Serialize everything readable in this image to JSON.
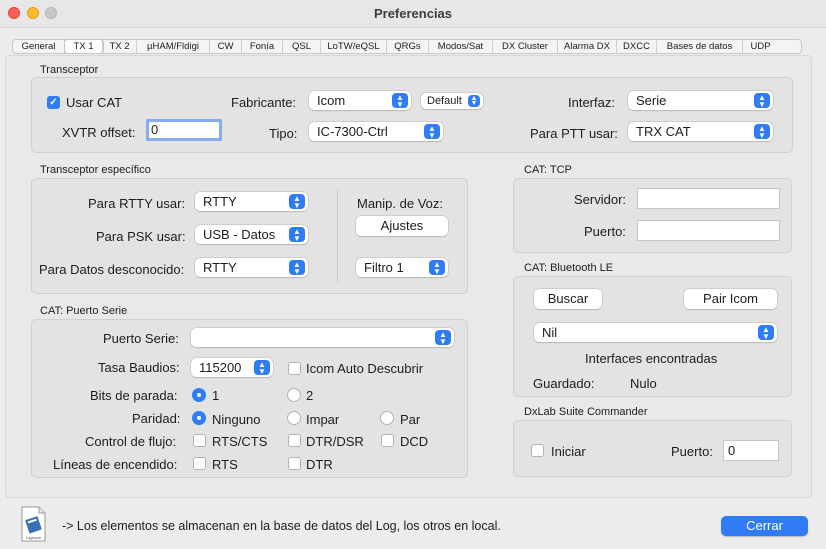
{
  "window": {
    "title": "Preferencias"
  },
  "tabs": [
    "General",
    "TX 1",
    "TX 2",
    "µHAM/Fldigi",
    "CW",
    "Fonía",
    "QSL",
    "LoTW/eQSL",
    "QRGs",
    "Modos/Sat",
    "DX Cluster",
    "Alarma DX",
    "DXCC",
    "Bases de datos",
    "UDP"
  ],
  "active_tab": "TX 1",
  "transceptor": {
    "title": "Transceptor",
    "usar_cat_label": "Usar CAT",
    "usar_cat_checked": true,
    "xvtr_label": "XVTR offset:",
    "xvtr_value": "0",
    "fabricante_label": "Fabricante:",
    "fabricante_value": "Icom",
    "default_value": "Default",
    "tipo_label": "Tipo:",
    "tipo_value": "IC-7300-Ctrl",
    "interfaz_label": "Interfaz:",
    "interfaz_value": "Serie",
    "ptt_label": "Para PTT usar:",
    "ptt_value": "TRX CAT"
  },
  "especifico": {
    "title": "Transceptor específico",
    "rtty_label": "Para RTTY usar:",
    "rtty_value": "RTTY",
    "psk_label": "Para PSK usar:",
    "psk_value": "USB - Datos",
    "datos_label": "Para Datos desconocido:",
    "datos_value": "RTTY",
    "manip_label": "Manip. de Voz:",
    "ajustes_label": "Ajustes",
    "filtro_value": "Filtro 1"
  },
  "puerto_serie": {
    "title": "CAT: Puerto Serie",
    "puerto_label": "Puerto Serie:",
    "puerto_value": "",
    "baudios_label": "Tasa Baudios:",
    "baudios_value": "115200",
    "auto_label": "Icom Auto Descubrir",
    "bits_label": "Bits de parada:",
    "bits_options": [
      "1",
      "2"
    ],
    "bits_selected": "1",
    "paridad_label": "Paridad:",
    "paridad_options": [
      "Ninguno",
      "Impar",
      "Par"
    ],
    "paridad_selected": "Ninguno",
    "flujo_label": "Control de flujo:",
    "flujo_options": [
      "RTS/CTS",
      "DTR/DSR",
      "DCD"
    ],
    "lineas_label": "Líneas de encendido:",
    "lineas_options": [
      "RTS",
      "DTR"
    ]
  },
  "tcp": {
    "title": "CAT: TCP",
    "servidor_label": "Servidor:",
    "servidor_value": "",
    "puerto_label": "Puerto:",
    "puerto_value": ""
  },
  "bluetooth": {
    "title": "CAT: Bluetooth LE",
    "buscar_label": "Buscar",
    "pair_label": "Pair Icom",
    "device_value": "Nil",
    "interfaces_label": "Interfaces encontradas",
    "guardado_label": "Guardado:",
    "guardado_value": "Nulo"
  },
  "dxlab": {
    "title": "DxLab Suite Commander",
    "iniciar_label": "Iniciar",
    "puerto_label": "Puerto:",
    "puerto_value": "0"
  },
  "footer": {
    "icon_text": "Logbook",
    "text": "-> Los elementos se almacenan en la base de datos del Log, los otros en local.",
    "cerrar_label": "Cerrar"
  },
  "colors": {
    "accent": "#2f7cf6",
    "focus_ring": "#83aef0"
  }
}
